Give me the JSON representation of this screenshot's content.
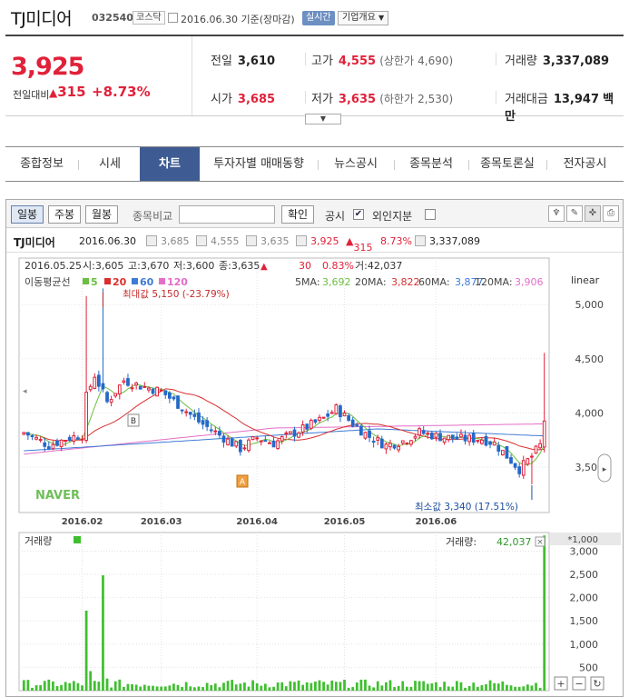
{
  "header": {
    "name": "TJ미디어",
    "code": "032540",
    "market": "코스닥",
    "date": "2016.06.30",
    "basis": "기준(장마감)",
    "realtime": "실시간",
    "company_info": "기업개요"
  },
  "quote": {
    "price": "3,925",
    "change_label": "전일대비",
    "change": "315",
    "change_pct": "+8.73%",
    "prev_label": "전일",
    "prev": "3,610",
    "high_label": "고가",
    "high": "4,555",
    "upper_label": "(상한가",
    "upper": "4,690)",
    "volume_label": "거래량",
    "volume": "3,337,089",
    "open_label": "시가",
    "open": "3,685",
    "low_label": "저가",
    "low": "3,635",
    "lower_label": "(하한가",
    "lower": "2,530)",
    "amount_label": "거래대금",
    "amount": "13,947",
    "amount_unit": "백만"
  },
  "tabs": [
    "종합정보",
    "시세",
    "차트",
    "투자자별 매매동향",
    "뉴스공시",
    "종목분석",
    "종목토론실",
    "전자공시"
  ],
  "toolbar": {
    "daily": "일봉",
    "weekly": "주봉",
    "monthly": "월봉",
    "compare_label": "종목비교",
    "compare_placeholder": "",
    "confirm": "확인",
    "disclosure": "공시",
    "foreign": "외인지분"
  },
  "summary": {
    "name": "TJ미디어",
    "date": "2016.06.30",
    "open": "3,685",
    "high": "4,555",
    "low": "3,635",
    "close": "3,925",
    "change": "315",
    "pct": "8.73%",
    "volume": "3,337,089"
  },
  "price_panel": {
    "info_date": "2016.05.25",
    "info_open": "시:3,605",
    "info_high": "고:3,670",
    "info_low": "저:3,600",
    "info_close": "종:3,635",
    "info_change": "30",
    "info_pct": "0.83%",
    "info_vol": "거:42,037",
    "ma_title": "이동평균선",
    "ma_legend": [
      "5",
      "20",
      "60",
      "120"
    ],
    "ma_values": [
      {
        "label": "5MA:",
        "value": "3,692"
      },
      {
        "label": "20MA:",
        "value": "3,822"
      },
      {
        "label": "60MA:",
        "value": "3,877"
      },
      {
        "label": "120MA:",
        "value": "3,906"
      }
    ],
    "scale": "linear",
    "max_label": "최대값 5,150 (-23.79%)",
    "min_label": "최소값 3,340 (17.51%)",
    "marker_b": "B",
    "marker_a": "A",
    "watermark": "NAVER"
  },
  "volume_panel": {
    "title": "거래량",
    "label": "거래량:",
    "value": "42,037",
    "multiplier": "*1,000"
  },
  "colors": {
    "up": "#e0213a",
    "down": "#2469c9",
    "ma5": "#6abf40",
    "ma20": "#d92f2f",
    "ma60": "#3e7bd6",
    "ma120": "#e46ec7",
    "volume": "#3fbf2f"
  },
  "chart_data": {
    "type": "candlestick",
    "price_ticks": [
      3500,
      4000,
      4500,
      5000
    ],
    "price_ylim": [
      3080,
      5430
    ],
    "volume_ticks": [
      500,
      1000,
      1500,
      2000,
      2500,
      3000
    ],
    "volume_ylim": [
      0,
      3400
    ],
    "x_ticks": [
      "2016.02",
      "2016.03",
      "2016.04",
      "2016.05",
      "2016.06"
    ],
    "month_starts": [
      14,
      33,
      56,
      77,
      99
    ],
    "n": 126,
    "candles": [],
    "volume": [],
    "ma5": [],
    "ma20": [],
    "ma60": [],
    "ma120": []
  }
}
